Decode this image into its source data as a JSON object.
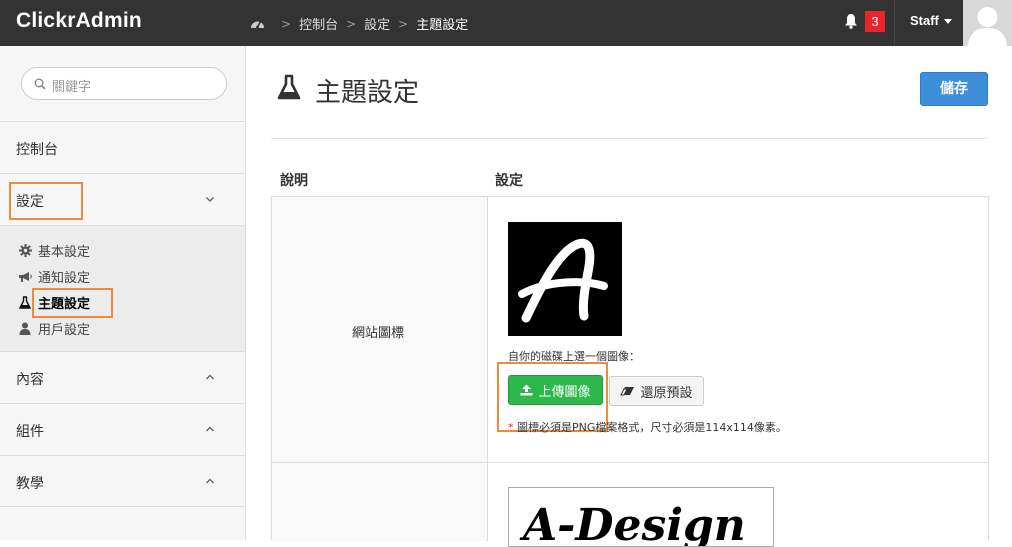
{
  "app": {
    "brand": "ClickrAdmin"
  },
  "breadcrumb": {
    "items": [
      "控制台",
      "設定",
      "主題設定"
    ]
  },
  "header": {
    "notification_count": "3",
    "user_label": "Staff"
  },
  "sidebar": {
    "search_placeholder": "關鍵字",
    "dashboard": "控制台",
    "settings": "設定",
    "settings_sub": [
      {
        "label": "基本設定",
        "icon": "gear-icon"
      },
      {
        "label": "通知設定",
        "icon": "megaphone-icon"
      },
      {
        "label": "主題設定",
        "icon": "flask-icon",
        "active": true
      },
      {
        "label": "用戶設定",
        "icon": "user-icon"
      }
    ],
    "content": "內容",
    "components": "組件",
    "tutorial": "教學"
  },
  "main": {
    "title": "主題設定",
    "save_label": "儲存",
    "columns": {
      "description": "說明",
      "setting": "設定"
    },
    "rows": [
      {
        "description": "網站圖標",
        "pick_text": "自你的磁碟上選一個圖像：",
        "upload_label": "上傳圖像",
        "reset_label": "還原預設",
        "note_star": "*",
        "note": "圖標必須是PNG檔案格式，尺寸必須是114x114像素。"
      }
    ],
    "logo_text": "A-Design"
  },
  "colors": {
    "topbar": "#333333",
    "primary": "#3d8fd9",
    "success": "#2db84b",
    "badge": "#e8242f",
    "highlight": "#f0883e"
  }
}
